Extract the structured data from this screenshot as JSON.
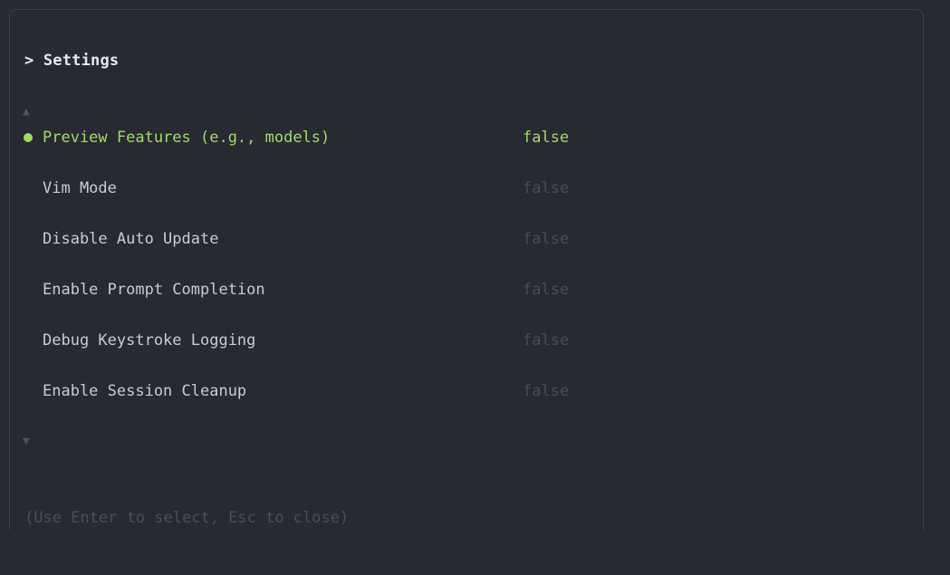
{
  "dialog": {
    "title": "> Settings",
    "scroll_up_icon": "triangle-up-icon",
    "scroll_down_icon": "triangle-down-icon",
    "hint": "(Use Enter to select, Esc to close)"
  },
  "settings": [
    {
      "label": "Preview Features (e.g., models)",
      "value": "false",
      "selected": true
    },
    {
      "label": "Vim Mode",
      "value": "false",
      "selected": false
    },
    {
      "label": "Disable Auto Update",
      "value": "false",
      "selected": false
    },
    {
      "label": "Enable Prompt Completion",
      "value": "false",
      "selected": false
    },
    {
      "label": "Debug Keystroke Logging",
      "value": "false",
      "selected": false
    },
    {
      "label": "Enable Session Cleanup",
      "value": "false",
      "selected": false
    }
  ],
  "colors": {
    "background": "#272a31",
    "accent": "#a3d96b",
    "text": "#c9cbd0",
    "muted": "#484c54"
  }
}
